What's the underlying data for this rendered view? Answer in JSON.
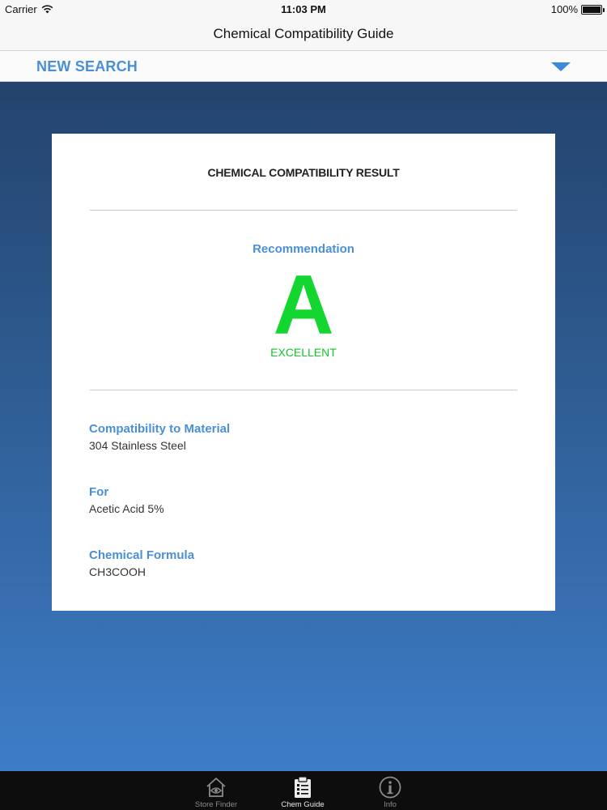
{
  "status_bar": {
    "carrier": "Carrier",
    "time": "11:03 PM",
    "battery": "100%"
  },
  "nav": {
    "title": "Chemical Compatibility Guide"
  },
  "search": {
    "label": "NEW SEARCH"
  },
  "card": {
    "title": "CHEMICAL COMPATIBILITY RESULT",
    "recommendation_label": "Recommendation",
    "grade": "A",
    "grade_text": "EXCELLENT",
    "details": [
      {
        "label": "Compatibility to Material",
        "value": "304 Stainless Steel"
      },
      {
        "label": "For",
        "value": "Acetic Acid 5%"
      },
      {
        "label": "Chemical Formula",
        "value": "CH3COOH"
      }
    ]
  },
  "tabs": [
    {
      "label": "Store Finder",
      "icon": "store-finder-icon",
      "active": false
    },
    {
      "label": "Chem Guide",
      "icon": "clipboard-icon",
      "active": true
    },
    {
      "label": "Info",
      "icon": "info-icon",
      "active": false
    }
  ],
  "colors": {
    "accent": "#4a8fd6",
    "grade_green": "#14d631",
    "tab_bar": "#0d0d0d"
  }
}
